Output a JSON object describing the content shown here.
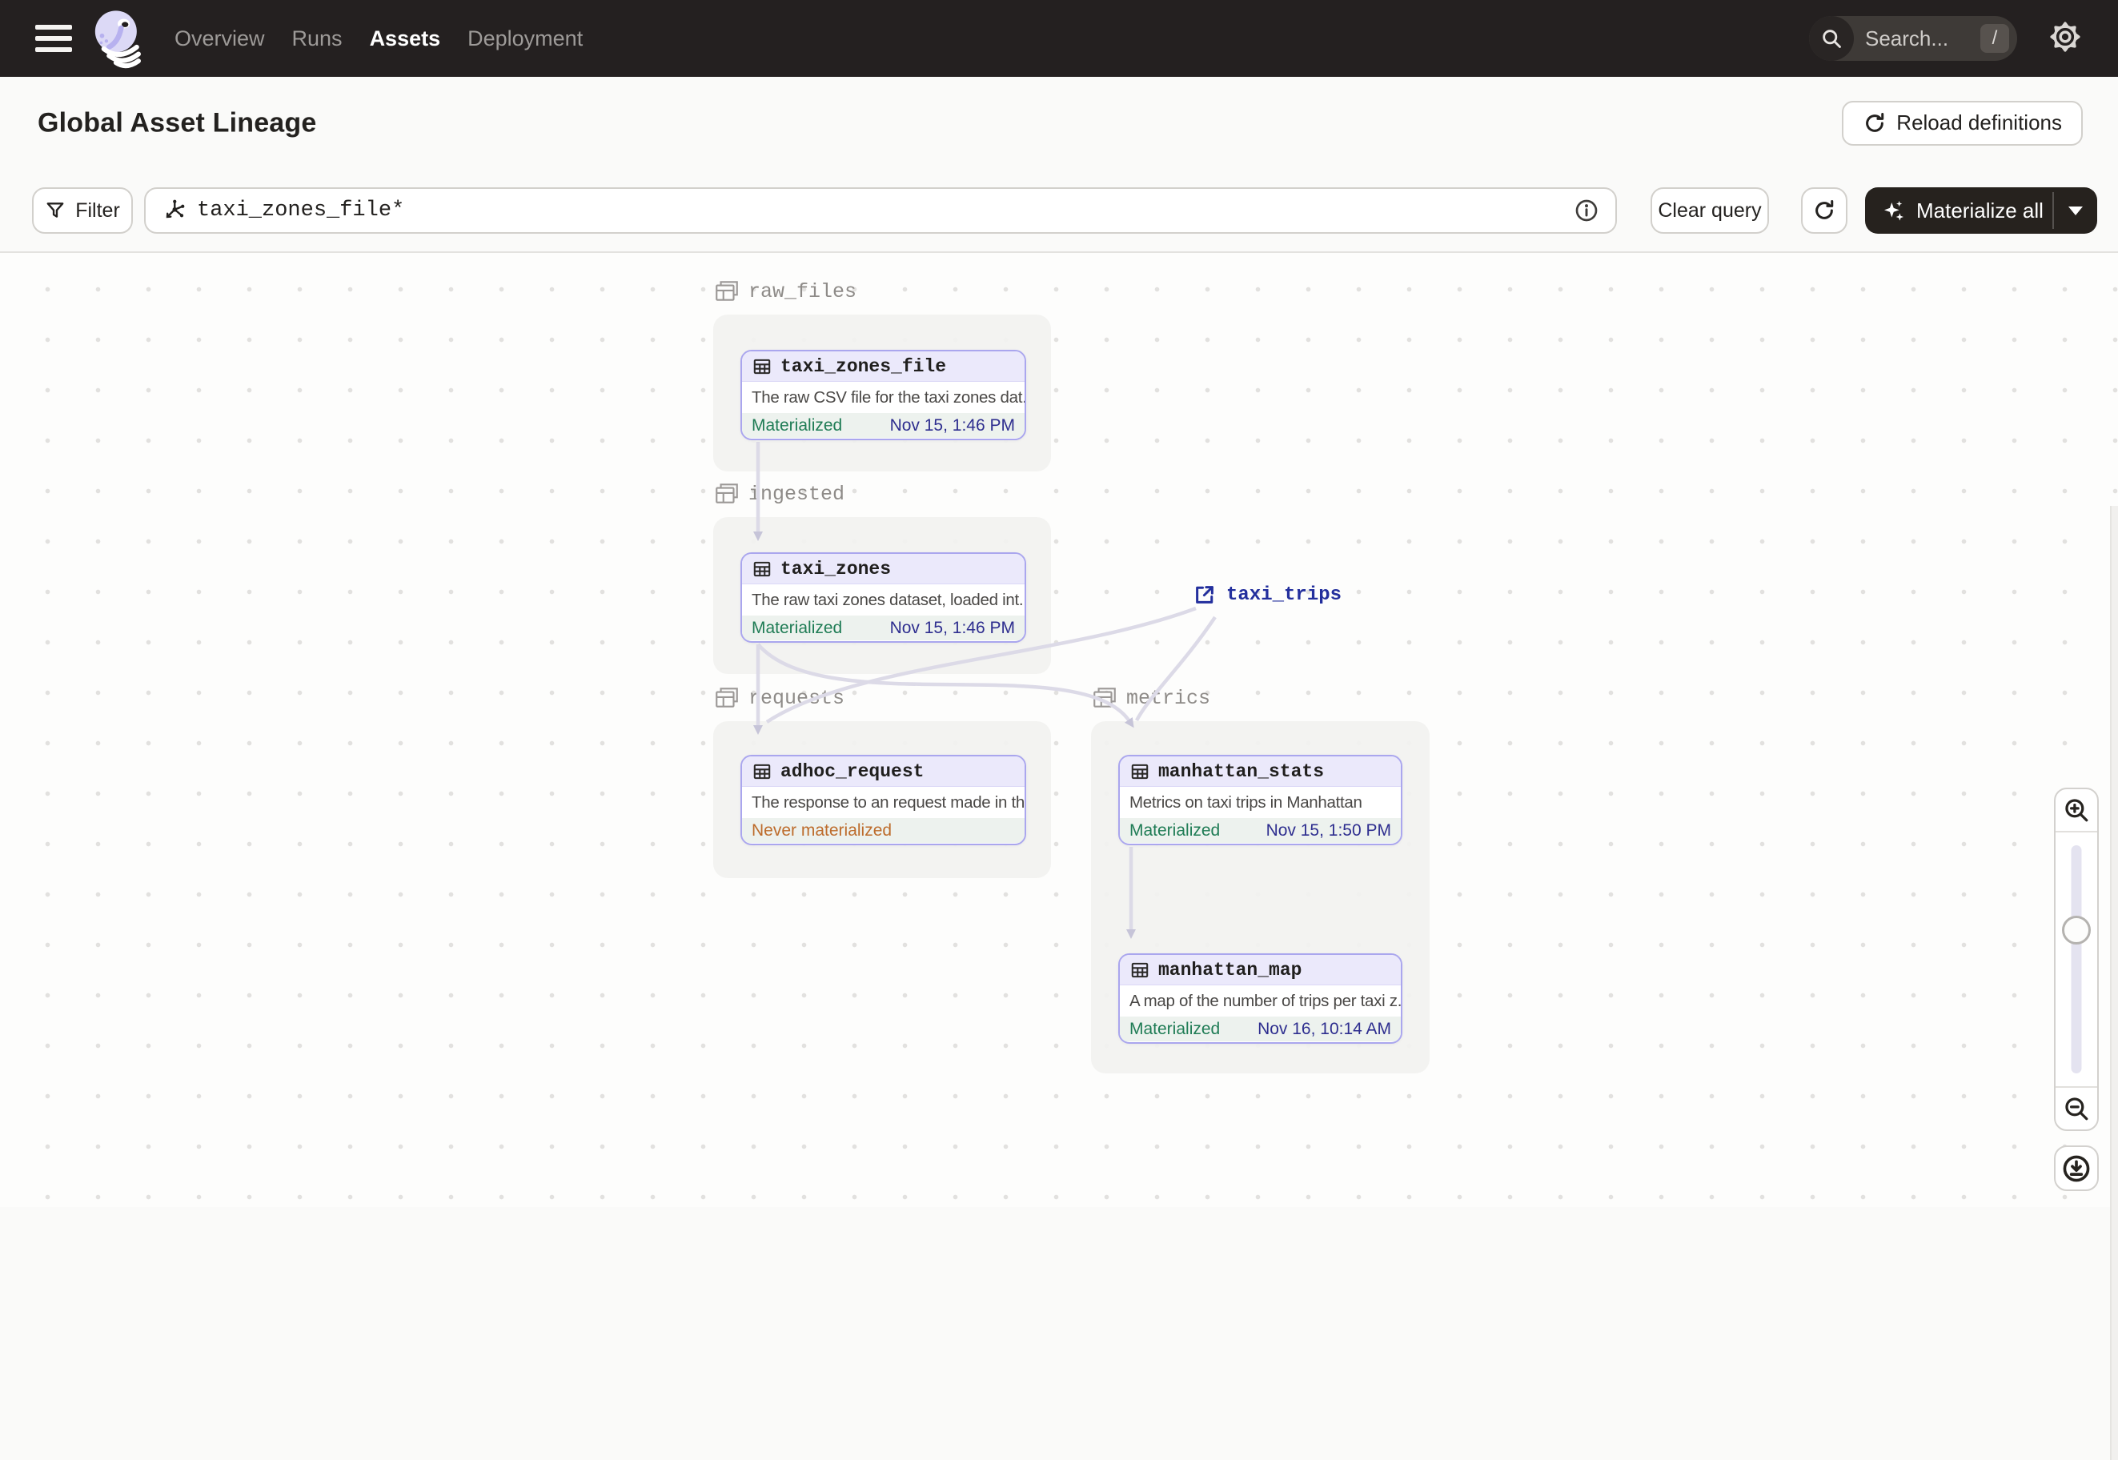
{
  "nav": {
    "links": [
      {
        "label": "Overview",
        "active": false
      },
      {
        "label": "Runs",
        "active": false
      },
      {
        "label": "Assets",
        "active": true
      },
      {
        "label": "Deployment",
        "active": false
      }
    ],
    "search": {
      "placeholder": "Search...",
      "shortcut": "/"
    }
  },
  "header": {
    "title": "Global Asset Lineage",
    "reload_button": "Reload definitions"
  },
  "toolbar": {
    "filter_button": "Filter",
    "query_value": "taxi_zones_file*",
    "clear_button": "Clear query",
    "materialize_button": "Materialize all"
  },
  "graph": {
    "groups": [
      {
        "name": "raw_files"
      },
      {
        "name": "ingested"
      },
      {
        "name": "requests"
      },
      {
        "name": "metrics"
      }
    ],
    "nodes": [
      {
        "name": "taxi_zones_file",
        "description": "The raw CSV file for the taxi zones dat...",
        "status": "Materialized",
        "timestamp": "Nov 15, 1:46 PM",
        "group": "raw_files"
      },
      {
        "name": "taxi_zones",
        "description": "The raw taxi zones dataset, loaded int...",
        "status": "Materialized",
        "timestamp": "Nov 15, 1:46 PM",
        "group": "ingested"
      },
      {
        "name": "adhoc_request",
        "description": "The response to an request made in th...",
        "status": "Never materialized",
        "timestamp": "",
        "group": "requests"
      },
      {
        "name": "manhattan_stats",
        "description": "Metrics on taxi trips in Manhattan",
        "status": "Materialized",
        "timestamp": "Nov 15, 1:50 PM",
        "group": "metrics"
      },
      {
        "name": "manhattan_map",
        "description": "A map of the number of trips per taxi z...",
        "status": "Materialized",
        "timestamp": "Nov 16, 10:14 AM",
        "group": "metrics"
      }
    ],
    "external_assets": [
      {
        "name": "taxi_trips"
      }
    ]
  },
  "colors": {
    "nav_bg": "#242020",
    "node_border_purple": "#aaa6ee",
    "node_header_purple": "#ebe9fb",
    "materialized_green": "#1f7c55",
    "never_materialized_orange": "#bd6c2c",
    "timestamp_blue": "#2e2e8f",
    "external_link_blue": "#232f9d",
    "edge_gray": "#dcdae7"
  }
}
